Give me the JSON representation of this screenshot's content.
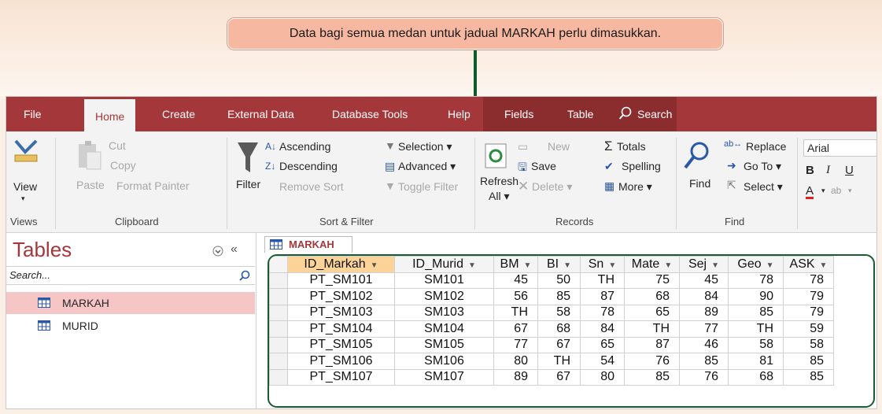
{
  "callout": {
    "text": "Data bagi semua medan untuk jadual MARKAH perlu dimasukkan."
  },
  "menu": {
    "tabs": [
      "File",
      "Home",
      "Create",
      "External Data",
      "Database Tools",
      "Help",
      "Fields",
      "Table"
    ],
    "search": "Search"
  },
  "ribbon": {
    "views": {
      "view": "View",
      "group": "Views"
    },
    "clipboard": {
      "paste": "Paste",
      "cut": "Cut",
      "copy": "Copy",
      "format_painter": "Format Painter",
      "group": "Clipboard"
    },
    "sort_filter": {
      "filter": "Filter",
      "ascending": "Ascending",
      "descending": "Descending",
      "remove_sort": "Remove Sort",
      "selection": "Selection ▾",
      "advanced": "Advanced ▾",
      "toggle_filter": "Toggle Filter",
      "group": "Sort & Filter"
    },
    "records": {
      "refresh": "Refresh",
      "all": "All ▾",
      "new": "New",
      "save": "Save",
      "delete": "Delete ▾",
      "totals": "Totals",
      "spelling": "Spelling",
      "more": "More ▾",
      "group": "Records"
    },
    "find": {
      "find": "Find",
      "replace": "Replace",
      "goto": "Go To ▾",
      "select": "Select ▾",
      "group": "Find"
    },
    "font": {
      "name": "Arial"
    }
  },
  "nav": {
    "title": "Tables",
    "search_placeholder": "Search...",
    "items": [
      "MARKAH",
      "MURID"
    ]
  },
  "document": {
    "tab": "MARKAH"
  },
  "table": {
    "columns": [
      "ID_Markah",
      "ID_Murid",
      "BM",
      "BI",
      "Sn",
      "Mate",
      "Sej",
      "Geo",
      "ASK"
    ],
    "rows": [
      [
        "PT_SM101",
        "SM101",
        "45",
        "50",
        "TH",
        "75",
        "45",
        "78",
        "78"
      ],
      [
        "PT_SM102",
        "SM102",
        "56",
        "85",
        "87",
        "68",
        "84",
        "90",
        "79"
      ],
      [
        "PT_SM103",
        "SM103",
        "TH",
        "58",
        "78",
        "65",
        "89",
        "85",
        "79"
      ],
      [
        "PT_SM104",
        "SM104",
        "67",
        "68",
        "84",
        "TH",
        "77",
        "TH",
        "59"
      ],
      [
        "PT_SM105",
        "SM105",
        "77",
        "67",
        "65",
        "87",
        "46",
        "58",
        "58"
      ],
      [
        "PT_SM106",
        "SM106",
        "80",
        "TH",
        "54",
        "76",
        "85",
        "81",
        "85"
      ],
      [
        "PT_SM107",
        "SM107",
        "89",
        "67",
        "80",
        "85",
        "76",
        "68",
        "85"
      ]
    ]
  },
  "colors": {
    "accent": "#a4373a",
    "callout": "#f7b8a2",
    "highlight_border": "#1a5c32"
  }
}
